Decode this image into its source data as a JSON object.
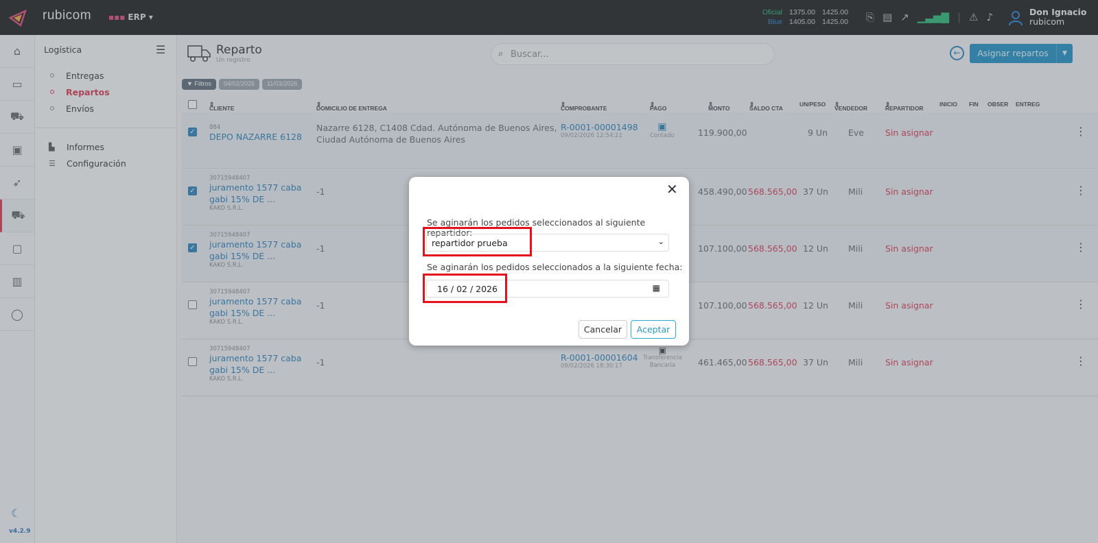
{
  "topbar": {
    "brand": "rubicom",
    "module": "ERP",
    "rates": [
      {
        "label": "Oficial",
        "buy": "1375.00",
        "sell": "1425.00",
        "color": "#2bb673"
      },
      {
        "label": "Blue",
        "buy": "1405.00",
        "sell": "1425.00",
        "color": "#2a80d8"
      }
    ],
    "user_name": "Don Ignacio",
    "user_company": "rubicom"
  },
  "rail": {
    "version": "v4.2.9"
  },
  "sidebar": {
    "title": "Logística",
    "items": [
      {
        "label": "Entregas"
      },
      {
        "label": "Repartos",
        "active": true
      },
      {
        "label": "Envíos"
      }
    ],
    "items2": [
      {
        "label": "Informes"
      },
      {
        "label": "Configuración"
      }
    ]
  },
  "page": {
    "title": "Reparto",
    "subtitle": "Un registro",
    "search_placeholder": "Buscar...",
    "assign_label": "Asignar repartos",
    "filters": [
      "Filtros",
      "04/02/2026",
      "11/03/2026"
    ]
  },
  "table": {
    "headers": [
      "CLIENTE",
      "DOMICILIO DE ENTREGA",
      "COMPROBANTE",
      "PAGO",
      "MONTO",
      "SALDO CTA",
      "UN/PESO",
      "VENDEDOR",
      "REPARTIDOR",
      "INICIO",
      "FIN",
      "OBSER",
      "ENTREG"
    ],
    "rows": [
      {
        "id": "884",
        "client": "DEPO NAZARRE 6128",
        "company": "",
        "address1": "Nazarre 6128, C1408 Cdad. Autónoma de Buenos Aires,",
        "address2": "Ciudad Autónoma de Buenos Aires",
        "comp": "R-0001-00001498",
        "date": "09/02/2026 12:54:21",
        "pay": "Contado",
        "monto": "119.900,00",
        "saldo": "",
        "unpeso": "9 Un",
        "vendedor": "Eve",
        "repartidor": "Sin asignar",
        "checked": true
      },
      {
        "id": "30715948407",
        "client": "juramento 1577 caba",
        "client2": "gabi 15% DE ...",
        "company": "KAKO S.R.L.",
        "address1": "-1",
        "address2": "",
        "comp": "",
        "date": "",
        "pay": "",
        "monto": "458.490,00",
        "saldo": "568.565,00",
        "unpeso": "37 Un",
        "vendedor": "Mili",
        "repartidor": "Sin asignar",
        "checked": true
      },
      {
        "id": "30715948407",
        "client": "juramento 1577 caba",
        "client2": "gabi 15% DE ...",
        "company": "KAKO S.R.L.",
        "address1": "-1",
        "address2": "",
        "comp": "",
        "date": "",
        "pay": "",
        "monto": "107.100,00",
        "saldo": "568.565,00",
        "unpeso": "12 Un",
        "vendedor": "Mili",
        "repartidor": "Sin asignar",
        "checked": true
      },
      {
        "id": "30715948407",
        "client": "juramento 1577 caba",
        "client2": "gabi 15% DE ...",
        "company": "KAKO S.R.L.",
        "address1": "-1",
        "address2": "",
        "comp": "",
        "date": "",
        "pay": "",
        "monto": "107.100,00",
        "saldo": "568.565,00",
        "unpeso": "12 Un",
        "vendedor": "Mili",
        "repartidor": "Sin asignar",
        "checked": false
      },
      {
        "id": "30715948407",
        "client": "juramento 1577 caba",
        "client2": "gabi 15% DE ...",
        "company": "KAKO S.R.L.",
        "address1": "-1",
        "address2": "",
        "comp": "R-0001-00001604",
        "date": "09/02/2026 18:30:17",
        "pay": "Transferencia",
        "pay2": "Bancaria",
        "monto": "461.465,00",
        "saldo": "568.565,00",
        "unpeso": "37 Un",
        "vendedor": "Mili",
        "repartidor": "Sin asignar",
        "checked": false
      }
    ]
  },
  "modal": {
    "label_repartidor": "Se aginarán los pedidos seleccionados al siguiente repartidor:",
    "repartidor_value": "repartidor prueba",
    "label_fecha": "Se aginarán los pedidos seleccionados a la siguiente fecha:",
    "fecha_value": "16 / 02 / 2026",
    "cancel": "Cancelar",
    "ok": "Aceptar"
  }
}
